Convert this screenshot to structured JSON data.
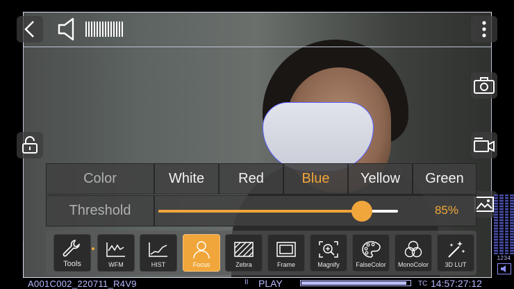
{
  "color_row": {
    "label": "Color",
    "options": [
      "White",
      "Red",
      "Blue",
      "Yellow",
      "Green"
    ],
    "selected": "Blue"
  },
  "threshold_row": {
    "label": "Threshold",
    "value": 0.85,
    "value_text": "85%"
  },
  "tools": [
    {
      "label": "Tools",
      "icon": "wrench-icon"
    },
    {
      "label": "WFM",
      "icon": "waveform-icon"
    },
    {
      "label": "HIST",
      "icon": "histogram-icon"
    },
    {
      "label": "Focus",
      "icon": "focus-person-icon",
      "active": true
    },
    {
      "label": "Zebra",
      "icon": "zebra-stripes-icon"
    },
    {
      "label": "Frame",
      "icon": "frame-icon"
    },
    {
      "label": "Magnify",
      "icon": "magnify-icon"
    },
    {
      "label": "FalseColor",
      "icon": "palette-icon"
    },
    {
      "label": "MonoColor",
      "icon": "circles-icon"
    },
    {
      "label": "3D LUT",
      "icon": "magic-wand-icon"
    }
  ],
  "status": {
    "clip_name": "A001C002_220711_R4V9",
    "pause_symbol": "II",
    "play_label": "PLAY",
    "playback_progress": 0.97,
    "tc_label": "TC",
    "timecode": "14:57:27:12"
  },
  "audio": {
    "channels": "1234",
    "volume_level_bars": 14
  },
  "colors": {
    "accent": "#f0a63a",
    "panel": "#404040",
    "status_text": "#b9bbff",
    "focus_peaking": "#5a60ff"
  }
}
